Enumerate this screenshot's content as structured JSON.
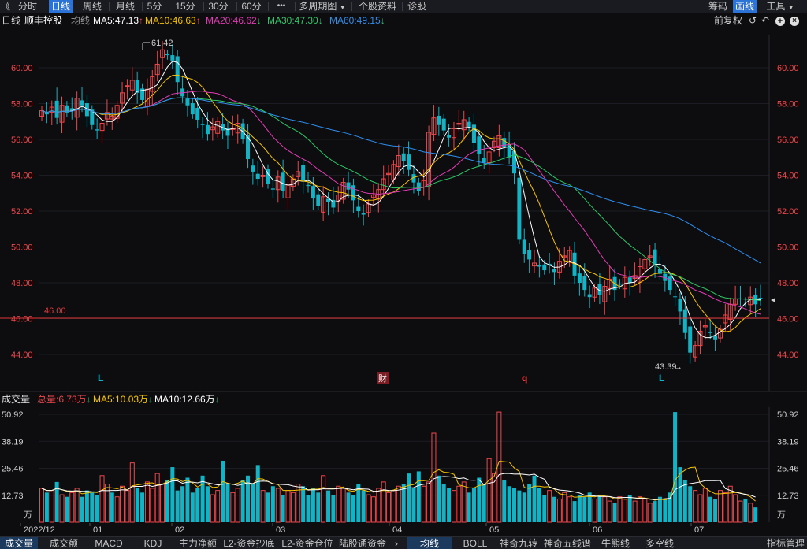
{
  "toolbar": {
    "back_icon": "back-chevron-icon",
    "tabs": [
      {
        "label": "分时",
        "active": false
      },
      {
        "label": "日线",
        "active": true
      },
      {
        "label": "周线",
        "active": false
      },
      {
        "label": "月线",
        "active": false
      },
      {
        "label": "5分",
        "active": false
      },
      {
        "label": "15分",
        "active": false
      },
      {
        "label": "30分",
        "active": false
      },
      {
        "label": "60分",
        "active": false
      },
      {
        "label": "•••",
        "active": false
      },
      {
        "label": "多周期图",
        "active": false
      },
      {
        "label": "个股资料",
        "active": false
      },
      {
        "label": "诊股",
        "active": false
      }
    ],
    "right": {
      "chip": "筹码",
      "draw": "画线",
      "tools": "工具"
    }
  },
  "header": {
    "period": "日线",
    "stock_name": "顺丰控股",
    "ma_label": "均线",
    "ma5": "MA5:47.13",
    "ma10": "MA10:46.63",
    "ma20": "MA20:46.62",
    "ma30": "MA30:47.30",
    "ma60": "MA60:49.15",
    "adjust": "前复权"
  },
  "colors": {
    "up": "#f0474b",
    "down": "#12b3c4",
    "ma5": "#ffffff",
    "ma10": "#f7c400",
    "ma20": "#e23cb4",
    "ma30": "#2ec766",
    "ma60": "#2f8ff0",
    "bg": "#0d0d10"
  },
  "price_axis": {
    "ticks": [
      "60.00",
      "58.00",
      "56.00",
      "54.00",
      "52.00",
      "50.00",
      "48.00",
      "46.00",
      "44.00"
    ],
    "tick_values": [
      60,
      58,
      56,
      54,
      52,
      50,
      48,
      46,
      44
    ]
  },
  "annotations": {
    "high_label": "61.42",
    "low_label": "43.39",
    "line_label": "46.00",
    "event_markers": [
      "L",
      "财",
      "q",
      "L"
    ]
  },
  "volume_header": {
    "title": "成交量",
    "total": "总量:6.73万",
    "ma5": "MA5:10.03万",
    "ma10": "MA10:12.66万"
  },
  "volume_axis": {
    "ticks": [
      "50.92",
      "38.19",
      "25.46",
      "12.73"
    ],
    "unit": "万"
  },
  "date_axis": [
    "2022/12",
    "01",
    "02",
    "03",
    "04",
    "05",
    "06",
    "07"
  ],
  "bottom_tabs": [
    {
      "label": "成交量",
      "active": true
    },
    {
      "label": "成交额",
      "active": false
    },
    {
      "label": "MACD",
      "active": false
    },
    {
      "label": "KDJ",
      "active": false
    },
    {
      "label": "主力净额",
      "active": false
    },
    {
      "label": "L2-资金抄底",
      "active": false
    },
    {
      "label": "L2-资金仓位",
      "active": false
    },
    {
      "label": "陆股通资金",
      "active": false
    },
    {
      "label": "均线",
      "active": true
    },
    {
      "label": "BOLL",
      "active": false
    },
    {
      "label": "神奇九转",
      "active": false
    },
    {
      "label": "神奇五线谱",
      "active": false
    },
    {
      "label": "牛熊线",
      "active": false
    },
    {
      "label": "多空线",
      "active": false
    },
    {
      "label": "指标管理",
      "active": false
    }
  ],
  "chart_data": {
    "type": "candlestick",
    "title": "顺丰控股 日线",
    "period": "2022/12 – 2023/07",
    "price_range": [
      43.0,
      62.0
    ],
    "volume_range_wan": [
      0,
      52
    ],
    "high": 61.42,
    "low": 43.39,
    "reference_line": 46.0,
    "close_series": [
      57.6,
      57.4,
      57.8,
      57.2,
      57.9,
      57.5,
      57.6,
      58.3,
      57.9,
      57.3,
      56.8,
      56.5,
      56.9,
      57.5,
      57.3,
      57.9,
      58.6,
      59.0,
      59.3,
      58.6,
      58.2,
      58.8,
      59.5,
      60.2,
      61.0,
      60.7,
      60.4,
      59.2,
      58.4,
      57.9,
      57.4,
      57.1,
      56.8,
      56.3,
      56.7,
      57.0,
      56.5,
      56.2,
      56.6,
      56.9,
      56.0,
      54.9,
      54.2,
      53.8,
      54.0,
      53.5,
      53.2,
      53.9,
      53.1,
      53.5,
      53.8,
      54.2,
      53.7,
      53.4,
      52.7,
      52.3,
      52.8,
      52.5,
      52.2,
      52.9,
      53.6,
      53.2,
      52.6,
      52.0,
      51.8,
      52.4,
      52.9,
      53.2,
      53.8,
      54.1,
      54.6,
      55.1,
      54.8,
      54.3,
      53.6,
      53.1,
      53.7,
      56.4,
      57.2,
      56.8,
      56.5,
      56.1,
      56.6,
      56.9,
      57.1,
      56.7,
      55.8,
      55.2,
      54.7,
      55.3,
      55.9,
      56.2,
      55.6,
      55.0,
      54.1,
      50.4,
      49.6,
      49.3,
      49.1,
      48.9,
      48.7,
      49.0,
      48.6,
      49.2,
      49.5,
      49.8,
      48.4,
      48.0,
      47.6,
      47.2,
      47.7,
      47.3,
      47.8,
      48.2,
      47.6,
      47.9,
      48.3,
      48.0,
      48.4,
      48.9,
      49.3,
      49.5,
      49.0,
      48.5,
      48.1,
      47.6,
      47.2,
      46.4,
      45.2,
      44.1,
      44.5,
      45.3,
      45.6,
      45.2,
      44.8,
      45.4,
      46.2,
      46.8,
      47.1,
      47.3,
      46.9,
      47.2,
      46.8,
      47.1
    ],
    "ma_series": {
      "MA5": 47.13,
      "MA10": 46.63,
      "MA20": 46.62,
      "MA30": 47.3,
      "MA60": 49.15
    },
    "volume_series_wan": [
      16,
      14,
      15,
      19,
      13,
      12,
      14,
      16,
      12,
      15,
      14,
      13,
      22,
      18,
      14,
      12,
      17,
      15,
      28,
      16,
      14,
      19,
      16,
      23,
      18,
      20,
      26,
      15,
      17,
      21,
      14,
      16,
      22,
      17,
      13,
      15,
      29,
      18,
      14,
      16,
      20,
      22,
      18,
      27,
      15,
      14,
      17,
      16,
      13,
      15,
      14,
      18,
      17,
      13,
      16,
      14,
      22,
      15,
      13,
      17,
      16,
      14,
      13,
      18,
      15,
      13,
      12,
      16,
      19,
      14,
      15,
      17,
      18,
      23,
      16,
      24,
      17,
      19,
      42,
      22,
      18,
      16,
      15,
      17,
      19,
      14,
      16,
      21,
      18,
      30,
      23,
      52,
      20,
      17,
      16,
      15,
      14,
      18,
      22,
      16,
      13,
      15,
      12,
      11,
      14,
      12,
      10,
      13,
      12,
      14,
      11,
      13,
      12,
      10,
      9,
      12,
      11,
      13,
      10,
      12,
      11,
      9,
      10,
      12,
      11,
      14,
      52,
      26,
      20,
      17,
      15,
      13,
      16,
      12,
      11,
      15,
      14,
      17,
      13,
      10,
      11,
      9,
      7
    ]
  }
}
